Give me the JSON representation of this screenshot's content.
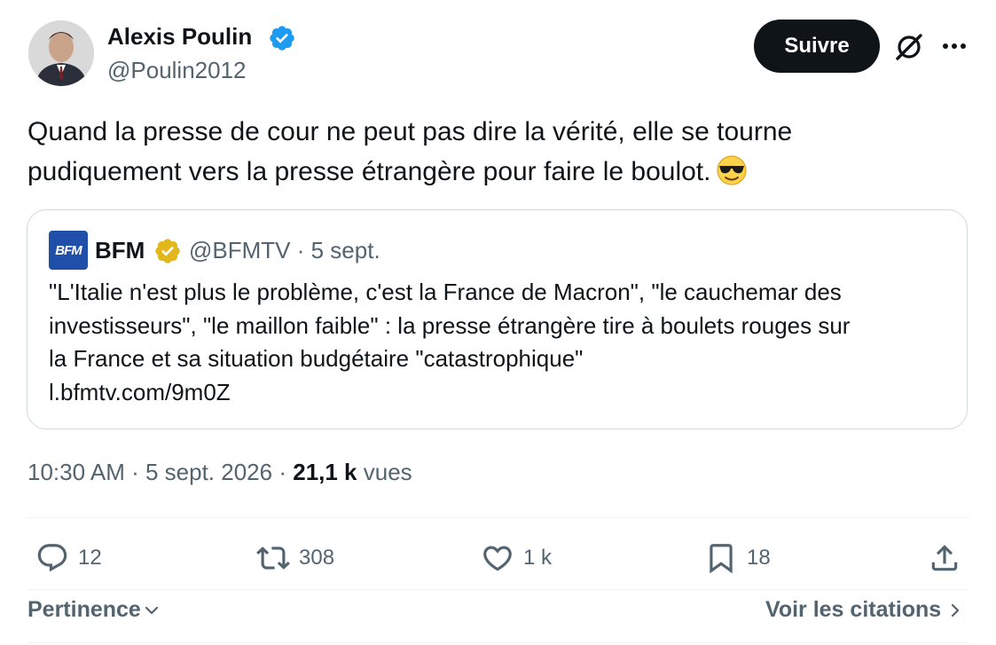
{
  "author": {
    "name": "Alexis Poulin",
    "handle": "@Poulin2012",
    "verified": true
  },
  "header": {
    "follow_label": "Suivre",
    "grok_icon": "grok-icon",
    "more_icon": "more-icon"
  },
  "tweet": {
    "lines": [
      "Quand la presse de cour ne peut pas dire la vérité, elle se tourne",
      "pudiquement vers la presse étrangère pour faire le boulot."
    ],
    "emoji": "smiling-face-with-sunglasses"
  },
  "quote": {
    "logo_text": "BFM",
    "name": "BFM",
    "handle": "@BFMTV",
    "date": "5 sept.",
    "lines": [
      "\"L'Italie n'est plus le problème, c'est la France de Macron\", \"le cauchemar des",
      "investisseurs\", \"le maillon faible\" : la presse étrangère tire à boulets rouges sur",
      "la France et sa situation budgétaire \"catastrophique\"",
      "l.bfmtv.com/9m0Z"
    ]
  },
  "meta": {
    "time": "10:30 AM",
    "date": "5 sept. 2026",
    "views": "21,1 k",
    "views_label": "vues"
  },
  "actions": {
    "replies": "12",
    "reposts": "308",
    "likes": "1 k",
    "bookmarks": "18"
  },
  "footer": {
    "sort_label": "Pertinence",
    "quotes_label": "Voir les citations"
  },
  "colors": {
    "text_primary": "#0f1419",
    "text_secondary": "#536471",
    "verified_blue": "#1d9bf0",
    "verified_gold": "#e2b719",
    "border": "#cfd9de"
  }
}
